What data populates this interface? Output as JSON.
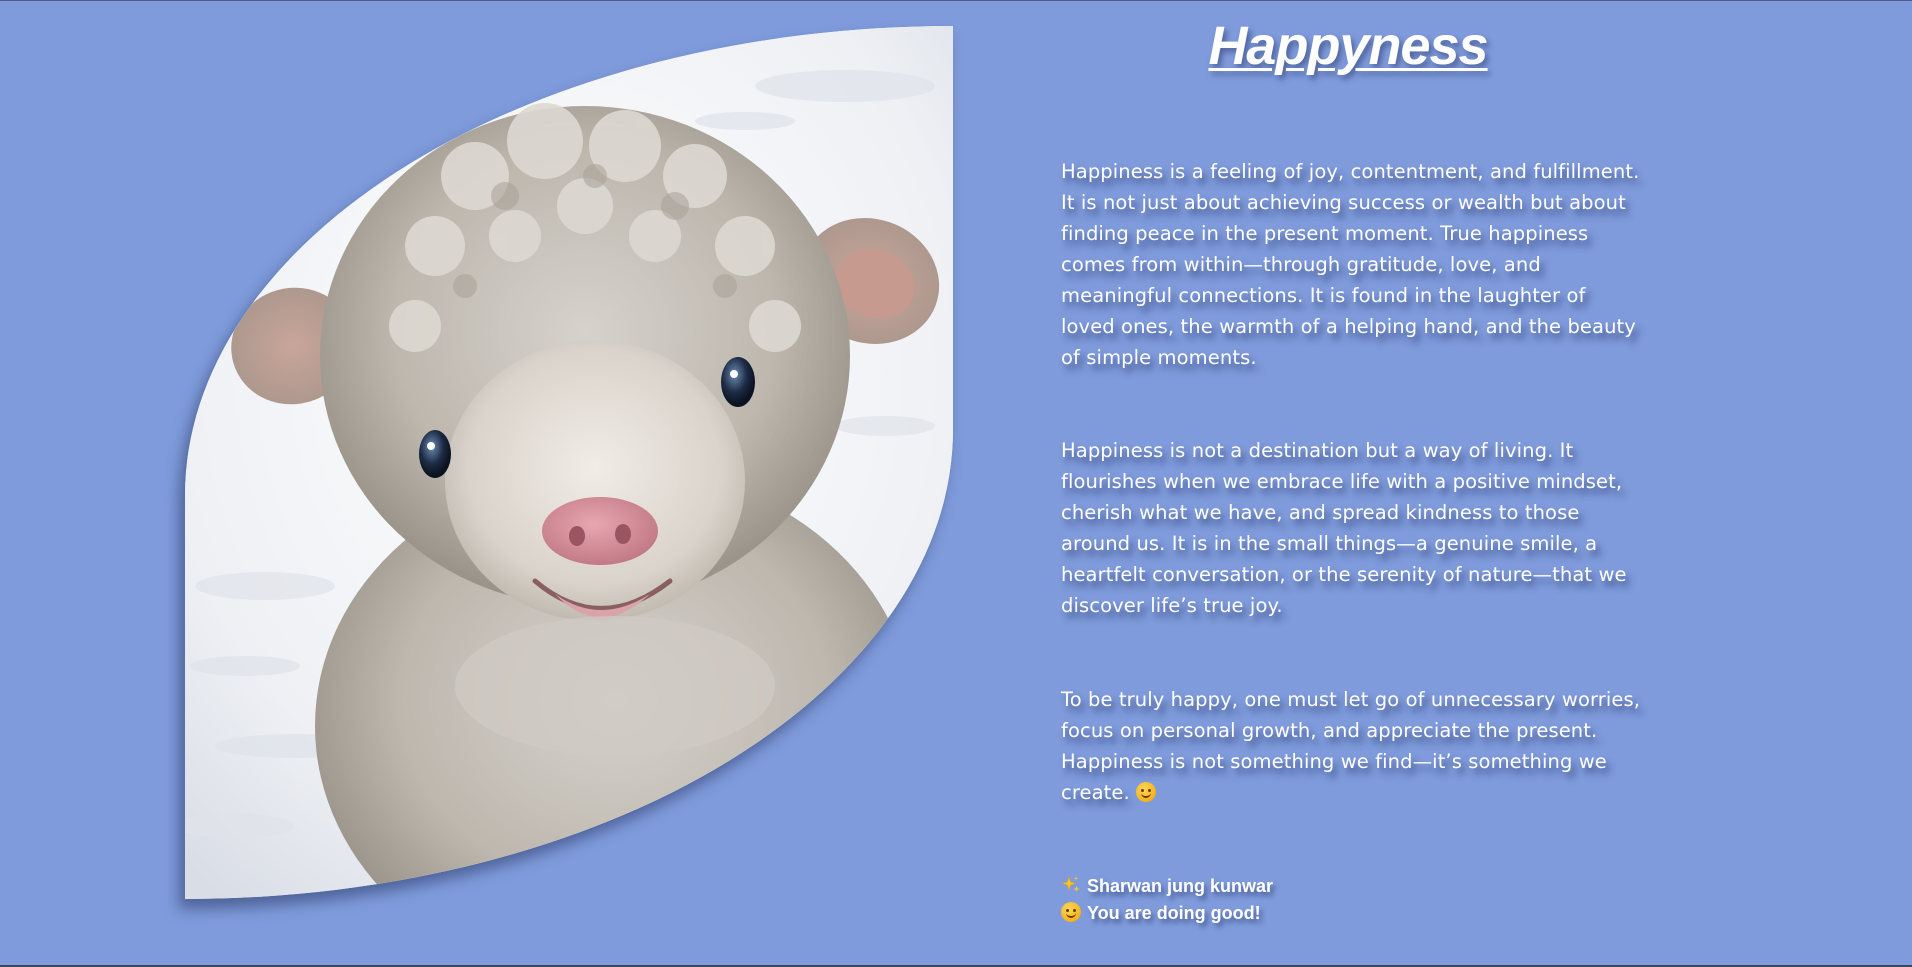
{
  "page": {
    "title": "Happyness",
    "background_color": "#7f9bdb",
    "text_color": "#ffffff"
  },
  "image": {
    "subject": "lamb-in-snow-photo"
  },
  "paragraphs": [
    {
      "text": "Happiness is a feeling of joy, contentment, and fulfillment. It is not just about achieving success or wealth but about finding peace in the present moment. True happiness comes from within—through gratitude, love, and meaningful connections. It is found in the laughter of loved ones, the warmth of a helping hand, and the beauty of simple moments."
    },
    {
      "text": "Happiness is not a destination but a way of living. It flourishes when we embrace life with a positive mindset, cherish what we have, and spread kindness to those around us. It is in the small things—a genuine smile, a heartfelt conversation, or the serenity of nature—that we discover life’s true joy."
    },
    {
      "text": "To be truly happy, one must let go of unnecessary worries, focus on personal growth, and appreciate the present. Happiness is not something we find—it’s something we create.",
      "trailing_icon": "smiling-face-emoji-icon"
    }
  ],
  "signature": {
    "author_icon": "sparkles-emoji-icon",
    "author": "Sharwan jung kunwar",
    "message_icon": "smiling-face-emoji-icon",
    "message": "You are doing good!"
  }
}
